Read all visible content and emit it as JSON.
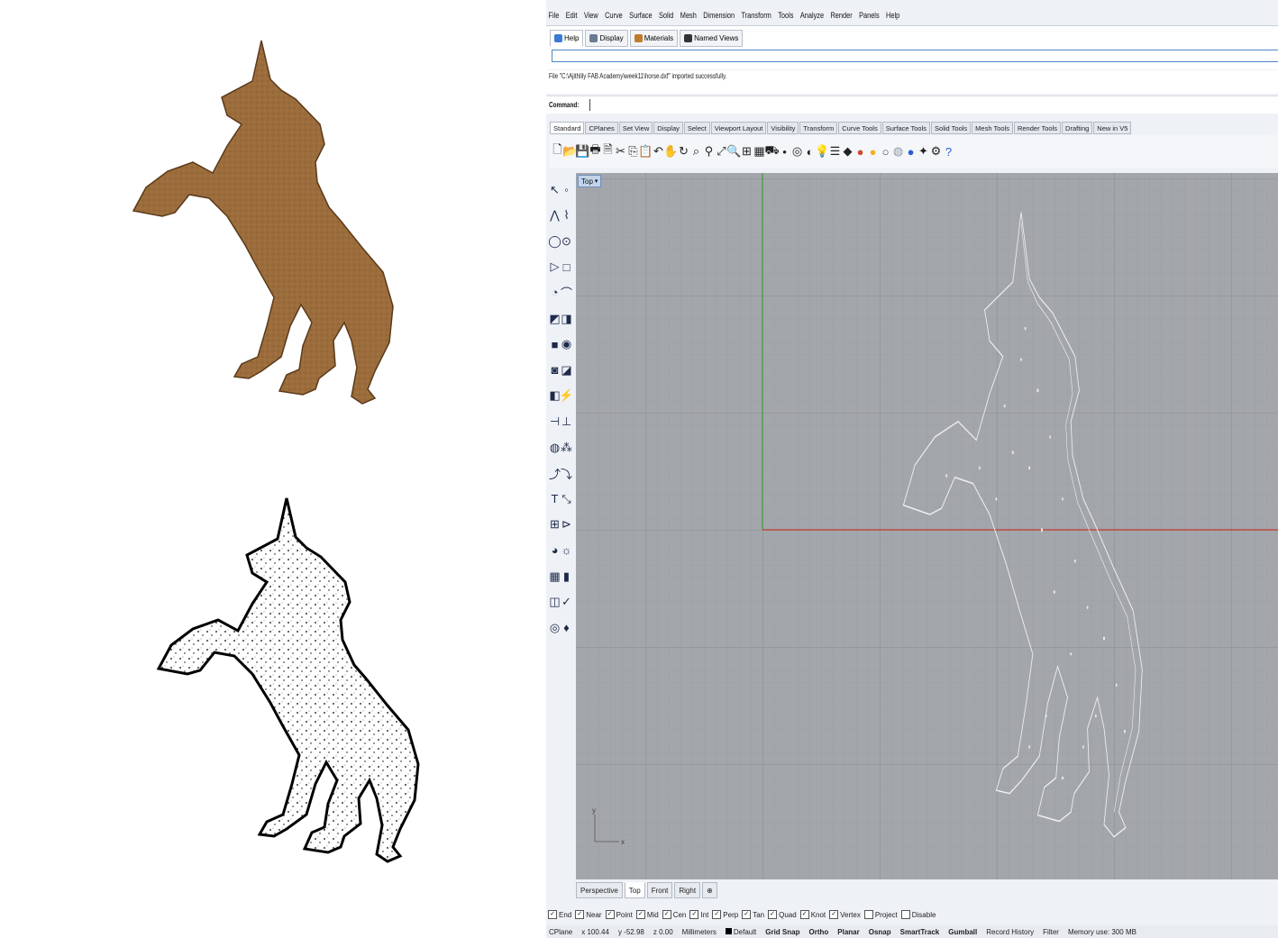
{
  "menu": [
    "File",
    "Edit",
    "View",
    "Curve",
    "Surface",
    "Solid",
    "Mesh",
    "Dimension",
    "Transform",
    "Tools",
    "Analyze",
    "Render",
    "Panels",
    "Help"
  ],
  "panel_tabs": [
    {
      "label": "Help",
      "color": "#3a7bd5"
    },
    {
      "label": "Display",
      "color": "#6a7c93"
    },
    {
      "label": "Materials",
      "color": "#c07a2a"
    },
    {
      "label": "Named Views",
      "color": "#333333"
    }
  ],
  "history": {
    "text": "File \"C:\\Ajithlily FAB Academy\\week11\\horse.dxf\" imported successfully."
  },
  "command": {
    "label": "Command:"
  },
  "toolbar_tabs": [
    "Standard",
    "CPlanes",
    "Set View",
    "Display",
    "Select",
    "Viewport Layout",
    "Visibility",
    "Transform",
    "Curve Tools",
    "Surface Tools",
    "Solid Tools",
    "Mesh Tools",
    "Render Tools",
    "Drafting",
    "New in V5"
  ],
  "toolbar_icons": [
    "new-file-icon",
    "open-file-icon",
    "save-icon",
    "print-icon",
    "import-icon",
    "cut-icon",
    "copy-icon",
    "paste-icon",
    "undo-icon",
    "pan-icon",
    "rotate-view-icon",
    "zoom-window-icon",
    "zoom-dynamic-icon",
    "zoom-extents-icon",
    "zoom-selected-icon",
    "four-viewports-icon",
    "grid-icon",
    "car-icon",
    "point-icon",
    "snap-icon",
    "display-mode-icon",
    "lightbulb-icon",
    "layer-icon",
    "properties-icon",
    "render-sphere-icon",
    "shaded-sphere-icon",
    "wire-sphere-icon",
    "ghost-sphere-icon",
    "material-sphere-icon",
    "options-icon",
    "gear-icon",
    "help-icon"
  ],
  "viewport": {
    "title": "Top"
  },
  "viewport_tabs": [
    "Perspective",
    "Top",
    "Front",
    "Right"
  ],
  "osnaps": [
    {
      "label": "End",
      "checked": true
    },
    {
      "label": "Near",
      "checked": true
    },
    {
      "label": "Point",
      "checked": true
    },
    {
      "label": "Mid",
      "checked": true
    },
    {
      "label": "Cen",
      "checked": true
    },
    {
      "label": "Int",
      "checked": true
    },
    {
      "label": "Perp",
      "checked": true
    },
    {
      "label": "Tan",
      "checked": true
    },
    {
      "label": "Quad",
      "checked": true
    },
    {
      "label": "Knot",
      "checked": true
    },
    {
      "label": "Vertex",
      "checked": true
    },
    {
      "label": "Project",
      "checked": false
    },
    {
      "label": "Disable",
      "checked": false
    }
  ],
  "status": {
    "cplane": "CPlane",
    "x": "x 100.44",
    "y": "y -52.98",
    "z": "z 0.00",
    "units": "Millimeters",
    "layer": "Default",
    "grid_snap": "Grid Snap",
    "ortho": "Ortho",
    "planar": "Planar",
    "osnap": "Osnap",
    "smarttrack": "SmartTrack",
    "gumball": "Gumball",
    "record_history": "Record History",
    "filter": "Filter",
    "memory": "Memory use: 300 MB"
  },
  "colors": {
    "wood": "#9a6b3a",
    "viewport_bg": "#a3a6ab",
    "x_axis": "#c0392b",
    "y_axis": "#3a9a3a",
    "accent": "#4f86c6"
  }
}
